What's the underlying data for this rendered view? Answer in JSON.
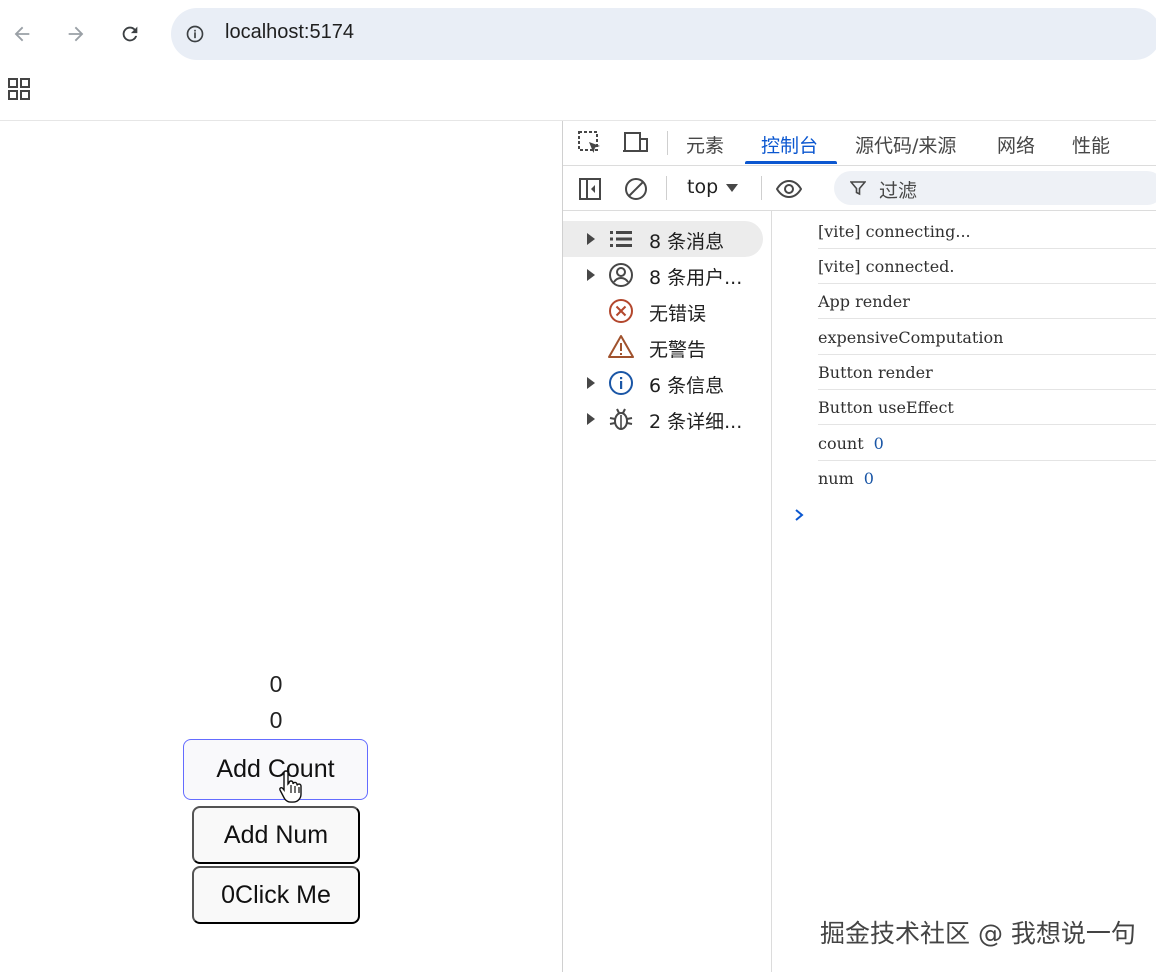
{
  "browser": {
    "url": "localhost:5174"
  },
  "page": {
    "count_value": "0",
    "num_value": "0",
    "buttons": {
      "add_count": "Add Count",
      "add_num": "Add Num",
      "click_me": "0Click Me"
    }
  },
  "devtools": {
    "tabs": [
      {
        "label": "元素",
        "active": false
      },
      {
        "label": "控制台",
        "active": true
      },
      {
        "label": "源代码/来源",
        "active": false
      },
      {
        "label": "网络",
        "active": false
      },
      {
        "label": "性能",
        "active": false
      }
    ],
    "context": "top",
    "filter_placeholder": "过滤",
    "sidebar": [
      {
        "label": "8 条消息",
        "icon": "list-icon",
        "expandable": true,
        "selected": true
      },
      {
        "label": "8 条用户...",
        "icon": "user-icon",
        "expandable": true,
        "selected": false
      },
      {
        "label": "无错误",
        "icon": "error-icon",
        "expandable": false,
        "selected": false
      },
      {
        "label": "无警告",
        "icon": "warning-icon",
        "expandable": false,
        "selected": false
      },
      {
        "label": "6 条信息",
        "icon": "info-icon",
        "expandable": true,
        "selected": false
      },
      {
        "label": "2 条详细...",
        "icon": "bug-icon",
        "expandable": true,
        "selected": false
      }
    ],
    "console_lines": [
      {
        "text": "[vite] connecting...",
        "value": ""
      },
      {
        "text": "[vite] connected.",
        "value": ""
      },
      {
        "text": "App render",
        "value": ""
      },
      {
        "text": "expensiveComputation",
        "value": ""
      },
      {
        "text": "Button render",
        "value": ""
      },
      {
        "text": "Button useEffect",
        "value": ""
      },
      {
        "text": "count",
        "value": "0"
      },
      {
        "text": "num",
        "value": "0"
      }
    ],
    "colors": {
      "accent": "#0b57d0",
      "error": "#c5221f",
      "warning": "#a0522d",
      "info": "#1a56a6"
    }
  },
  "watermark": "掘金技术社区 @ 我想说一句"
}
